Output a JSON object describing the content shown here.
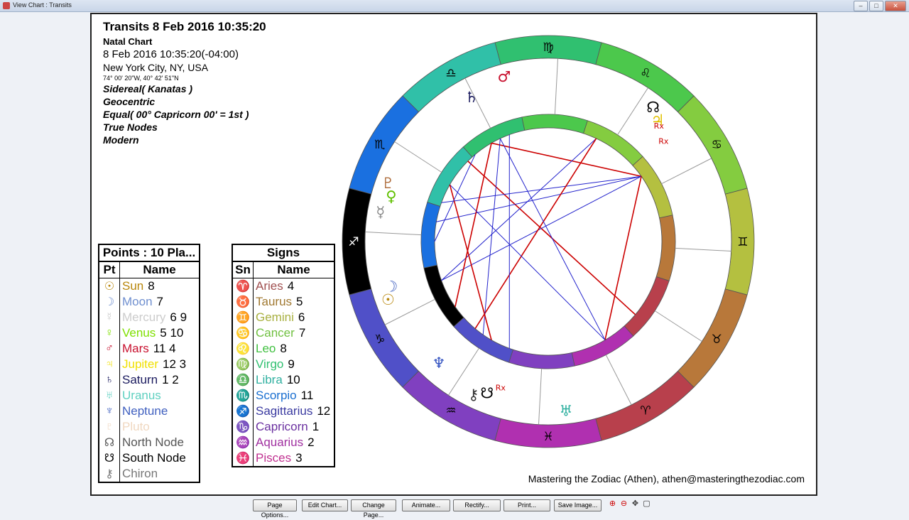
{
  "window": {
    "title": "View Chart : Transits"
  },
  "header": {
    "title": "Transits 8 Feb 2016 10:35:20",
    "subtitle": "Natal Chart",
    "datetime": "8 Feb 2016 10:35:20(-04:00)",
    "location": "New York City, NY, USA",
    "coords": "74° 00' 20\"W, 40° 42' 51\"N",
    "settings": [
      "Sidereal( Kanatas )",
      "Geocentric",
      "Equal( 00° Capricorn 00' = 1st )",
      "True Nodes",
      "Modern"
    ]
  },
  "points_table": {
    "caption": "Points : 10 Pla...",
    "col_pt": "Pt",
    "col_name": "Name",
    "rows": [
      {
        "glyph": "☉",
        "name": "Sun",
        "num": "8",
        "color": "#b8860b"
      },
      {
        "glyph": "☽",
        "name": "Moon",
        "num": "7",
        "color": "#6f8fcf"
      },
      {
        "glyph": "☿",
        "name": "Mercury",
        "num": "6 9",
        "color": "#cccccc"
      },
      {
        "glyph": "♀",
        "name": "Venus",
        "num": "5 10",
        "color": "#7fe000"
      },
      {
        "glyph": "♂",
        "name": "Mars",
        "num": "11 4",
        "color": "#c8102e"
      },
      {
        "glyph": "♃",
        "name": "Jupiter",
        "num": "12 3",
        "color": "#f0e000"
      },
      {
        "glyph": "♄",
        "name": "Saturn",
        "num": "1 2",
        "color": "#1a1a5e"
      },
      {
        "glyph": "♅",
        "name": "Uranus",
        "num": "",
        "color": "#5fd0c0"
      },
      {
        "glyph": "♆",
        "name": "Neptune",
        "num": "",
        "color": "#3f5fbf"
      },
      {
        "glyph": "♇",
        "name": "Pluto",
        "num": "",
        "color": "#f0d8c0"
      },
      {
        "glyph": "☊",
        "name": "North Node",
        "num": "",
        "color": "#555555"
      },
      {
        "glyph": "☋",
        "name": "South Node",
        "num": "",
        "color": "#000000"
      },
      {
        "glyph": "⚷",
        "name": "Chiron",
        "num": "",
        "color": "#777777"
      }
    ]
  },
  "signs_table": {
    "caption": "Signs",
    "col_sn": "Sn",
    "col_name": "Name",
    "rows": [
      {
        "glyph": "♈",
        "name": "Aries",
        "num": "4",
        "color": "#a05050"
      },
      {
        "glyph": "♉",
        "name": "Taurus",
        "num": "5",
        "color": "#a07830"
      },
      {
        "glyph": "♊",
        "name": "Gemini",
        "num": "6",
        "color": "#a8b040"
      },
      {
        "glyph": "♋",
        "name": "Cancer",
        "num": "7",
        "color": "#70c040"
      },
      {
        "glyph": "♌",
        "name": "Leo",
        "num": "8",
        "color": "#40c040"
      },
      {
        "glyph": "♍",
        "name": "Virgo",
        "num": "9",
        "color": "#30c070"
      },
      {
        "glyph": "♎",
        "name": "Libra",
        "num": "10",
        "color": "#30b0a0"
      },
      {
        "glyph": "♏",
        "name": "Scorpio",
        "num": "11",
        "color": "#1a6fd0"
      },
      {
        "glyph": "♐",
        "name": "Sagittarius",
        "num": "12",
        "color": "#3a3aa0"
      },
      {
        "glyph": "♑",
        "name": "Capricorn",
        "num": "1",
        "color": "#6a30a0"
      },
      {
        "glyph": "♒",
        "name": "Aquarius",
        "num": "2",
        "color": "#a030a0"
      },
      {
        "glyph": "♓",
        "name": "Pisces",
        "num": "3",
        "color": "#c03090"
      }
    ]
  },
  "chart": {
    "zodiac_signs": [
      {
        "glyph": "♈",
        "color": "#b8404c"
      },
      {
        "glyph": "♉",
        "color": "#b8783a"
      },
      {
        "glyph": "♊",
        "color": "#b4c040"
      },
      {
        "glyph": "♋",
        "color": "#84cc40"
      },
      {
        "glyph": "♌",
        "color": "#4cc84c"
      },
      {
        "glyph": "♍",
        "color": "#30c070"
      },
      {
        "glyph": "♎",
        "color": "#30c0a8"
      },
      {
        "glyph": "♏",
        "color": "#1a70e0"
      },
      {
        "glyph": "♐",
        "color": "#000000"
      },
      {
        "glyph": "♑",
        "color": "#5050c8"
      },
      {
        "glyph": "♒",
        "color": "#8040c0"
      },
      {
        "glyph": "♓",
        "color": "#b030b0"
      }
    ],
    "outer_planets": [
      {
        "glyph": "♂",
        "color": "#c8102e"
      },
      {
        "glyph": "♄",
        "color": "#1a1a5e"
      },
      {
        "glyph": "☊",
        "color": "#000000"
      },
      {
        "glyph": "♃",
        "color": "#e0c000"
      },
      {
        "glyph": "♇",
        "color": "#b07040"
      },
      {
        "glyph": "♀",
        "color": "#60c000"
      },
      {
        "glyph": "☿",
        "color": "#888888"
      },
      {
        "glyph": "☽",
        "color": "#4060c0"
      },
      {
        "glyph": "☉",
        "color": "#b8860b"
      },
      {
        "glyph": "♆",
        "color": "#3050c0"
      },
      {
        "glyph": "⚷",
        "color": "#333333"
      },
      {
        "glyph": "☋",
        "color": "#000000"
      },
      {
        "glyph": "♅",
        "color": "#30b0a0"
      }
    ],
    "retro_marker": "Rx"
  },
  "footer": "Mastering the Zodiac (Athen), athen@masteringthezodiac.com",
  "buttons": [
    "Page Options...",
    "Edit Chart...",
    "Change Page...",
    "Animate...",
    "Rectify...",
    "Print...",
    "Save Image..."
  ],
  "zoom_icons": [
    "zoom-in-icon",
    "zoom-out-icon",
    "pan-icon",
    "fit-icon"
  ]
}
